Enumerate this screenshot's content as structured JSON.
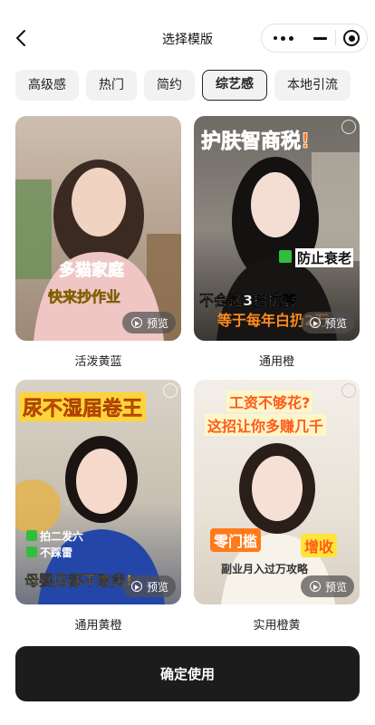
{
  "header": {
    "title": "选择模版"
  },
  "tabs": [
    {
      "label": "高级感",
      "active": false
    },
    {
      "label": "热门",
      "active": false
    },
    {
      "label": "简约",
      "active": false
    },
    {
      "label": "综艺感",
      "active": true
    },
    {
      "label": "本地引流",
      "active": false
    }
  ],
  "templates": [
    {
      "label": "活泼黄蓝",
      "preview": "预览",
      "overlay": {
        "line1": "多猫家庭",
        "line2": "快来抄作业"
      }
    },
    {
      "label": "通用橙",
      "preview": "预览",
      "overlay": {
        "headline": "护肤智商税!",
        "tag": "防止衰老",
        "line1": "不会这3招抗衰",
        "line2": "等于每年白扔2万"
      }
    },
    {
      "label": "通用黄橙",
      "preview": "预览",
      "overlay": {
        "headline": "尿不湿届卷王",
        "check1": "拍二发六",
        "check2": "不踩雷",
        "line1": "母婴店都不敢卖!"
      }
    },
    {
      "label": "实用橙黄",
      "preview": "预览",
      "overlay": {
        "headline1": "工资不够花?",
        "headline2": "这招让你多赚几千",
        "tag1": "零门槛",
        "tag2": "增收",
        "line1": "副业月入过万攻略"
      }
    }
  ],
  "confirm_label": "确定使用",
  "colors": {
    "confirm_bg": "#1c1c1c",
    "tab_bg": "#f2f2f3",
    "accent_orange": "#ff6a00"
  },
  "icons": {
    "back": "chevron-left-icon",
    "more": "more-dots-icon",
    "minimize": "minimize-icon",
    "close": "target-circle-icon",
    "play": "play-circle-icon"
  }
}
